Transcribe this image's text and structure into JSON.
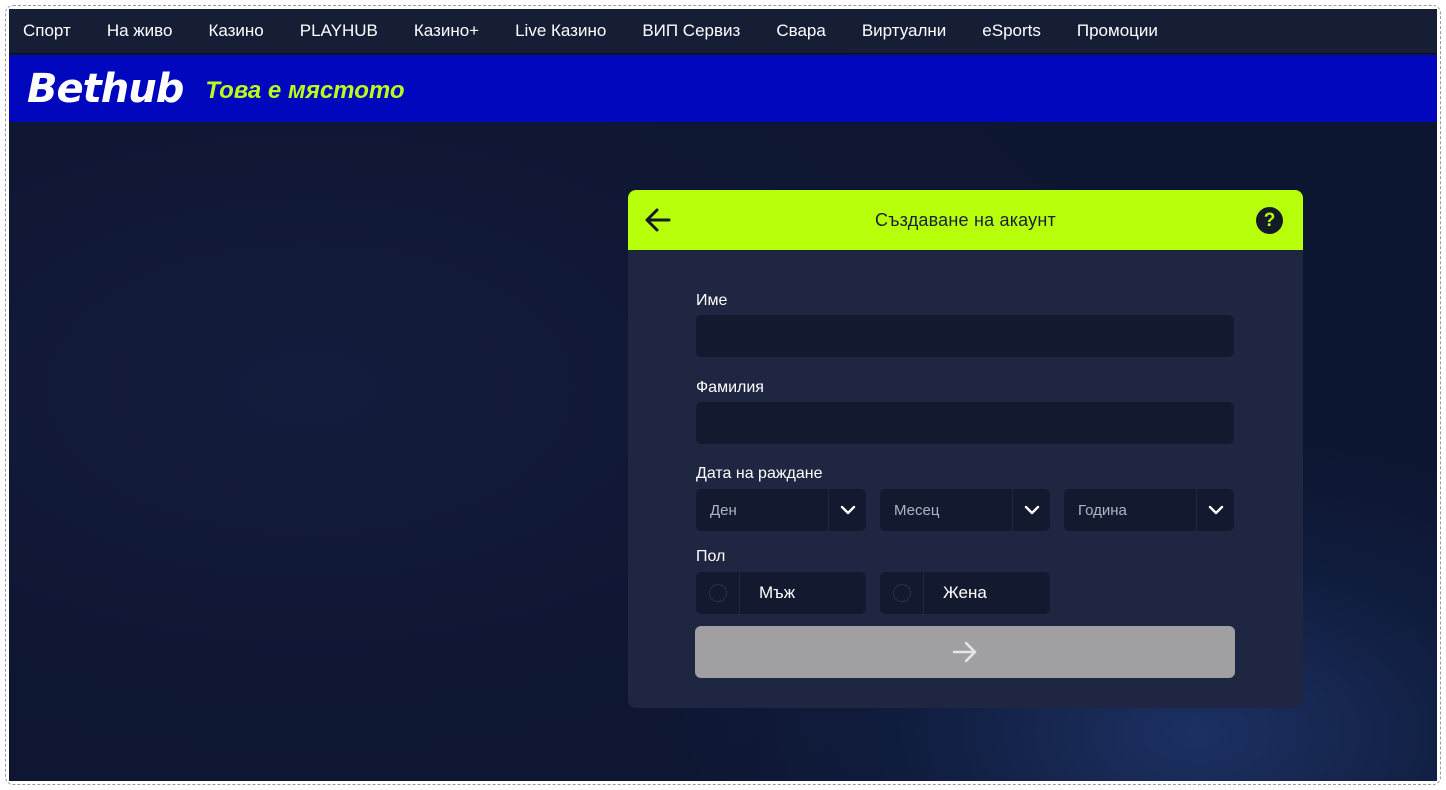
{
  "nav": {
    "items": [
      "Спорт",
      "На живо",
      "Казино",
      "PLAYHUB",
      "Казино+",
      "Live Казино",
      "ВИП Сервиз",
      "Свара",
      "Виртуални",
      "eSports",
      "Промоции"
    ]
  },
  "brand": {
    "logo": "Bethub",
    "tagline": "Това е мястото",
    "bar_color": "#0007bd",
    "accent": "#b7ff0a"
  },
  "card": {
    "title": "Създаване на акаунт",
    "help": "?",
    "fields": {
      "first_name_label": "Име",
      "first_name_value": "",
      "last_name_label": "Фамилия",
      "last_name_value": "",
      "dob_label": "Дата на раждане",
      "day": "Ден",
      "month": "Месец",
      "year": "Година",
      "gender_label": "Пол",
      "male": "Мъж",
      "female": "Жена"
    },
    "submit_color": "#a0a0a3"
  }
}
